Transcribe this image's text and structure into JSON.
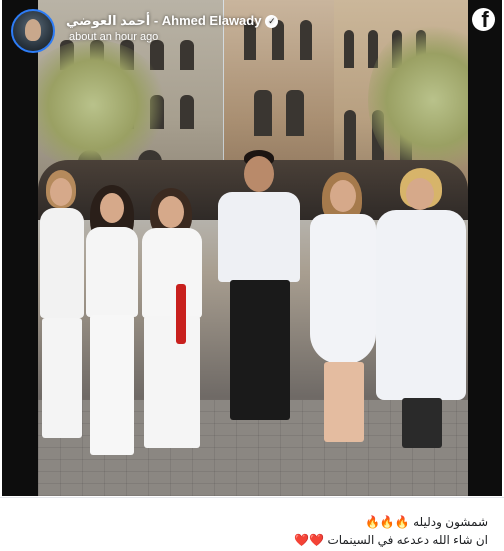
{
  "post": {
    "author_name": "أحمد العوضي - Ahmed Elawady",
    "verified_icon": "verified-badge-icon",
    "timestamp": "about an hour ago",
    "platform_icon": "facebook-logo-icon",
    "platform_letter": "f",
    "caption_line_1": "شمشون ودليله 🔥🔥🔥",
    "caption_line_2": "ان شاء الله دعدعه في السينمات ❤️❤️"
  },
  "colors": {
    "avatar_ring": "#2d7cf6",
    "text_on_photo": "#ffffff",
    "caption_text": "#1c1e21",
    "photo_frame": "#0d0d0d"
  }
}
